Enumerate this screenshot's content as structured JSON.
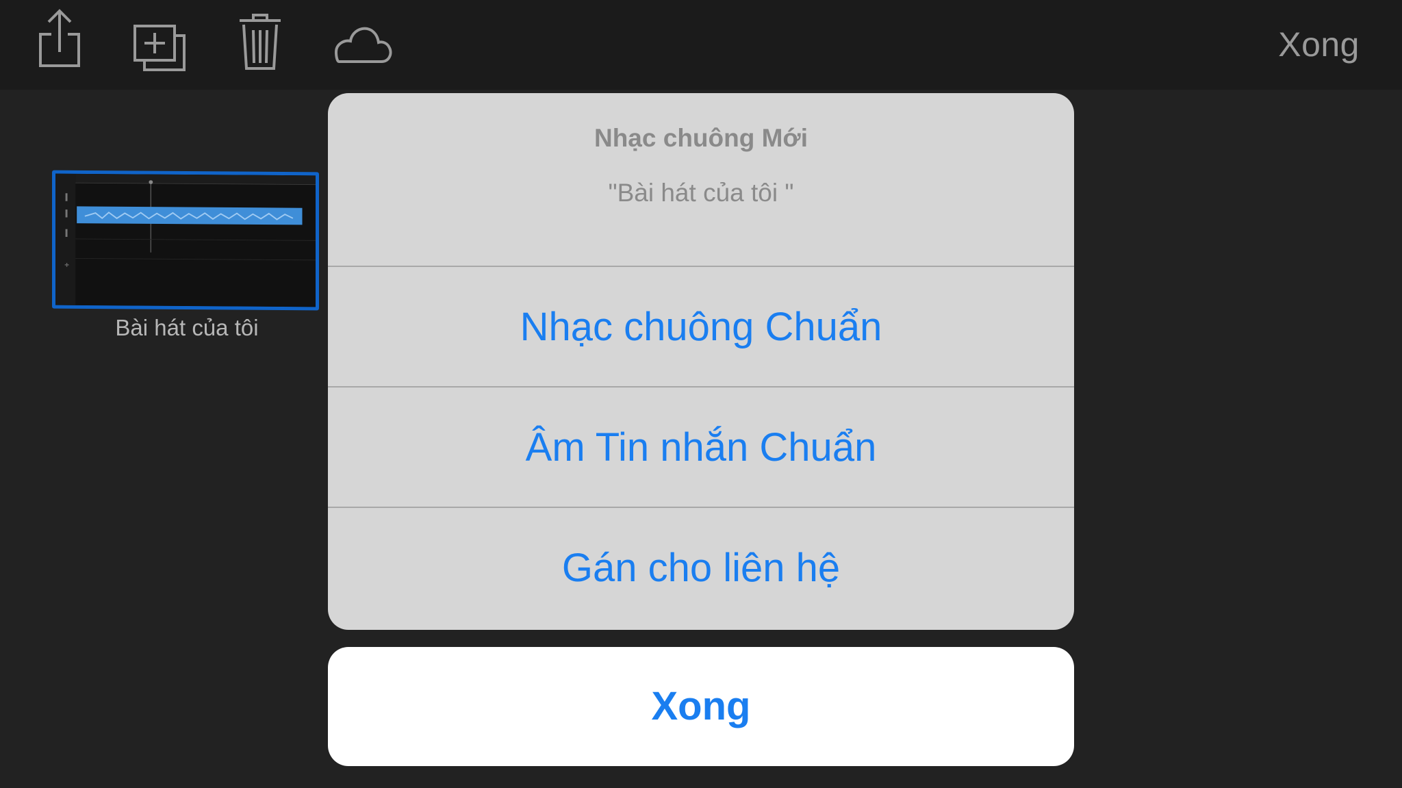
{
  "toolbar": {
    "icons": [
      "share-icon",
      "duplicate-icon",
      "trash-icon",
      "cloud-icon"
    ],
    "done_label": "Xong"
  },
  "song": {
    "title": "Bài hát của tôi"
  },
  "action_sheet": {
    "title": "Nhạc chuông Mới",
    "message": "\"Bài hát của tôi \"",
    "actions": [
      {
        "label": "Nhạc chuông Chuẩn"
      },
      {
        "label": "Âm Tin nhắn Chuẩn"
      },
      {
        "label": "Gán cho liên hệ"
      }
    ],
    "cancel_label": "Xong"
  },
  "colors": {
    "accent": "#1a7ef0",
    "selection_border": "#1064c9",
    "sheet_background": "#d6d6d6",
    "screen_background": "#222222"
  }
}
